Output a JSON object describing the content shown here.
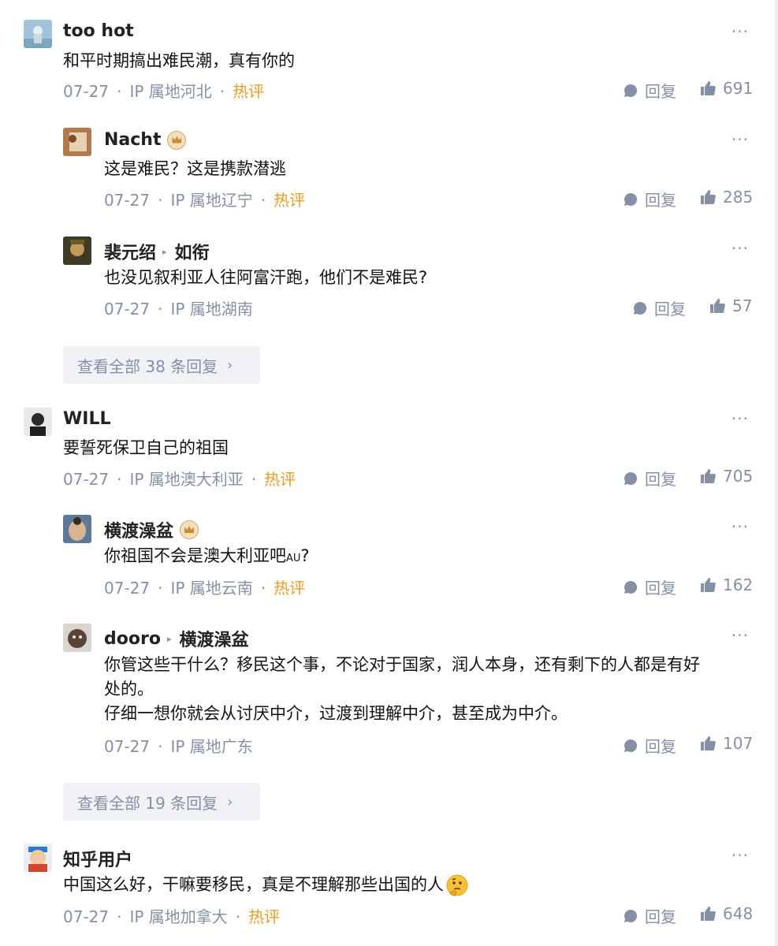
{
  "comments": [
    {
      "author": "too hot",
      "text": "和平时期搞出难民潮，真有你的",
      "date": "07-27",
      "ip": "IP 属地河北",
      "hot": "热评",
      "reply": "回复",
      "likes": "691",
      "replies": [
        {
          "author": "Nacht",
          "text": "这是难民？这是携款潜逃",
          "date": "07-27",
          "ip": "IP 属地辽宁",
          "hot": "热评",
          "reply": "回复",
          "likes": "285"
        },
        {
          "author": "裴元绍",
          "reply_to": "如衔",
          "text": "也没见叙利亚人往阿富汗跑，他们不是难民?",
          "date": "07-27",
          "ip": "IP 属地湖南",
          "reply": "回复",
          "likes": "57"
        }
      ],
      "view_all": "查看全部 38 条回复"
    },
    {
      "author": "WILL",
      "text": "要誓死保卫自己的祖国",
      "date": "07-27",
      "ip": "IP 属地澳大利亚",
      "hot": "热评",
      "reply": "回复",
      "likes": "705",
      "replies": [
        {
          "author": "横渡澡盆",
          "text": "你祖国不会是澳大利亚吧",
          "text_small": "AU",
          "text_end": "?",
          "date": "07-27",
          "ip": "IP 属地云南",
          "hot": "热评",
          "reply": "回复",
          "likes": "162"
        },
        {
          "author": "dooro",
          "reply_to": "横渡澡盆",
          "text1": "你管这些干什么？移民这个事，不论对于国家，润人本身，还有剩下的人都是有好",
          "text2": "处的。",
          "text3": "仔细一想你就会从讨厌中介，过渡到理解中介，甚至成为中介。",
          "date": "07-27",
          "ip": "IP 属地广东",
          "reply": "回复",
          "likes": "107"
        }
      ],
      "view_all": "查看全部 19 条回复"
    },
    {
      "author": "知乎用户",
      "text": "中国这么好，干嘛要移民，真是不理解那些出国的人",
      "date": "07-27",
      "ip": "IP 属地加拿大",
      "hot": "热评",
      "reply": "回复",
      "likes": "648"
    }
  ],
  "ui": {
    "more": "···",
    "dot": "·",
    "chevron": "›",
    "arrow": "▸"
  },
  "icons": {
    "reply": "reply-bubble-icon",
    "like": "thumbs-up-icon",
    "crown": "crown-badge-icon",
    "emoji": "thinking-face-emoji"
  },
  "colors": {
    "hot": "#f09a1a",
    "meta": "#8590a6",
    "button_bg": "#f0f2f5"
  }
}
